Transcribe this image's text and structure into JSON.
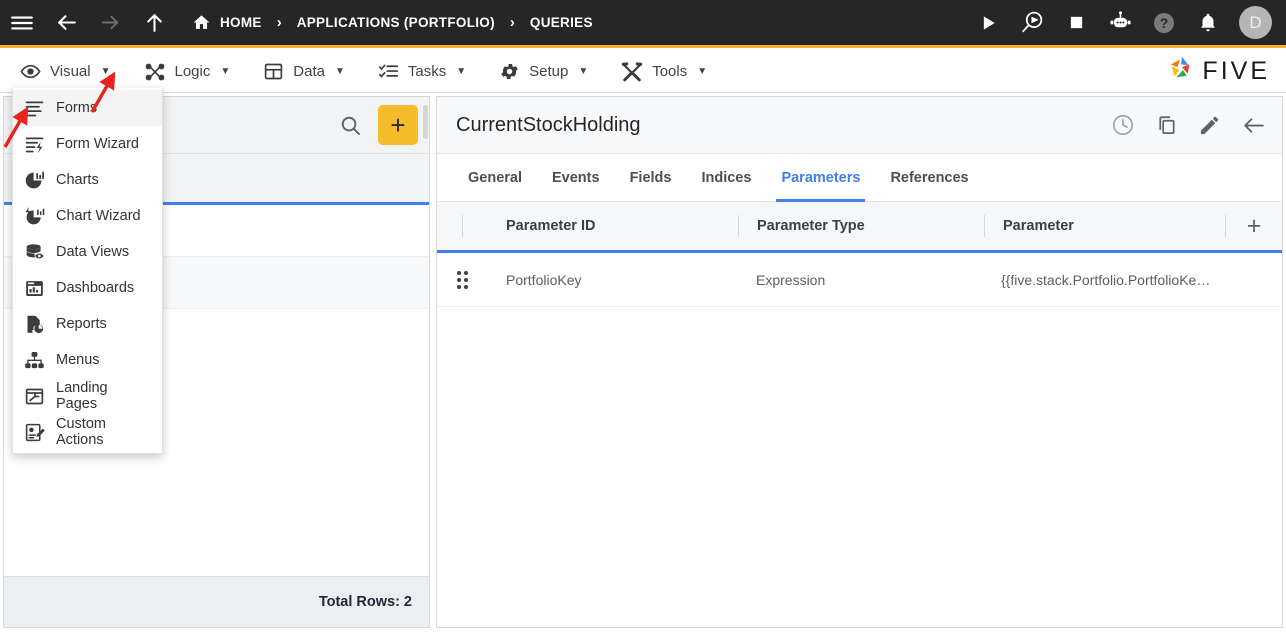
{
  "topbar": {
    "icons": [
      {
        "name": "hamburger-menu-icon",
        "label": "Menu"
      },
      {
        "name": "back-arrow-icon",
        "label": "Back"
      },
      {
        "name": "forward-arrow-icon",
        "label": "Forward"
      },
      {
        "name": "up-arrow-icon",
        "label": "Up"
      }
    ],
    "breadcrumbs": [
      {
        "label": "HOME",
        "icon": "home-icon"
      },
      {
        "label": "APPLICATIONS (PORTFOLIO)",
        "icon": ""
      },
      {
        "label": "QUERIES",
        "icon": ""
      }
    ],
    "separator": "›",
    "right_icons": [
      {
        "name": "run-play-icon",
        "label": "Run"
      },
      {
        "name": "debug-search-play-icon",
        "label": "Debug"
      },
      {
        "name": "stop-square-icon",
        "label": "Stop"
      },
      {
        "name": "chatbot-icon",
        "label": "Assistant"
      },
      {
        "name": "help-question-icon",
        "label": "Help"
      },
      {
        "name": "notification-bell-icon",
        "label": "Notifications"
      }
    ],
    "avatar_initial": "D",
    "accent_color": "#f0b323",
    "background_color": "#262626"
  },
  "menubar": {
    "items": [
      {
        "label": "Visual",
        "icon": "eye-icon",
        "caret": "▼",
        "active": true
      },
      {
        "label": "Logic",
        "icon": "workflow-icon",
        "caret": "▼",
        "active": false
      },
      {
        "label": "Data",
        "icon": "table-icon",
        "caret": "▼",
        "active": false
      },
      {
        "label": "Tasks",
        "icon": "checklist-icon",
        "caret": "▼",
        "active": false
      },
      {
        "label": "Setup",
        "icon": "gear-icon",
        "caret": "▼",
        "active": false
      },
      {
        "label": "Tools",
        "icon": "tools-icon",
        "caret": "▼",
        "active": false
      }
    ],
    "brand": "FIVE"
  },
  "dropdown": {
    "open_for": "Visual",
    "items": [
      {
        "label": "Forms",
        "icon": "forms-icon",
        "highlighted": true
      },
      {
        "label": "Form Wizard",
        "icon": "form-wizard-icon",
        "highlighted": false
      },
      {
        "label": "Charts",
        "icon": "charts-icon",
        "highlighted": false
      },
      {
        "label": "Chart Wizard",
        "icon": "chart-wizard-icon",
        "highlighted": false
      },
      {
        "label": "Data Views",
        "icon": "data-views-icon",
        "highlighted": false
      },
      {
        "label": "Dashboards",
        "icon": "dashboards-icon",
        "highlighted": false
      },
      {
        "label": "Reports",
        "icon": "reports-icon",
        "highlighted": false
      },
      {
        "label": "Menus",
        "icon": "menus-icon",
        "highlighted": false
      },
      {
        "label": "Landing Pages",
        "icon": "landing-pages-icon",
        "highlighted": false
      },
      {
        "label": "Custom Actions",
        "icon": "custom-actions-icon",
        "highlighted": false
      }
    ]
  },
  "left_panel": {
    "search_icon": "search-icon",
    "add_button_label": "+",
    "add_button_color": "#f5bb2a",
    "footer_text": "Total Rows: 2"
  },
  "right_panel": {
    "title": "CurrentStockHolding",
    "actions": [
      {
        "name": "history-clock-icon",
        "label": "History"
      },
      {
        "name": "duplicate-copy-icon",
        "label": "Duplicate"
      },
      {
        "name": "edit-pencil-icon",
        "label": "Edit"
      },
      {
        "name": "back-arrow-icon",
        "label": "Back"
      }
    ],
    "tabs": [
      {
        "label": "General",
        "active": false
      },
      {
        "label": "Events",
        "active": false
      },
      {
        "label": "Fields",
        "active": false
      },
      {
        "label": "Indices",
        "active": false
      },
      {
        "label": "Parameters",
        "active": true
      },
      {
        "label": "References",
        "active": false
      }
    ],
    "table": {
      "columns": [
        "Parameter ID",
        "Parameter Type",
        "Parameter"
      ],
      "add_column_label": "+",
      "rows": [
        {
          "handle": "drag-handle-icon",
          "parameter_id": "PortfolioKey",
          "parameter_type": "Expression",
          "parameter": "{{five.stack.Portfolio.PortfolioKe…"
        }
      ]
    },
    "accent_color": "#3f80ea"
  },
  "annotations": {
    "arrow_color": "#e8241c",
    "arrows": [
      {
        "name": "annotation-arrow-visual-caret",
        "target": "Visual dropdown caret"
      },
      {
        "name": "annotation-arrow-forms-item",
        "target": "Forms menu item"
      }
    ]
  }
}
